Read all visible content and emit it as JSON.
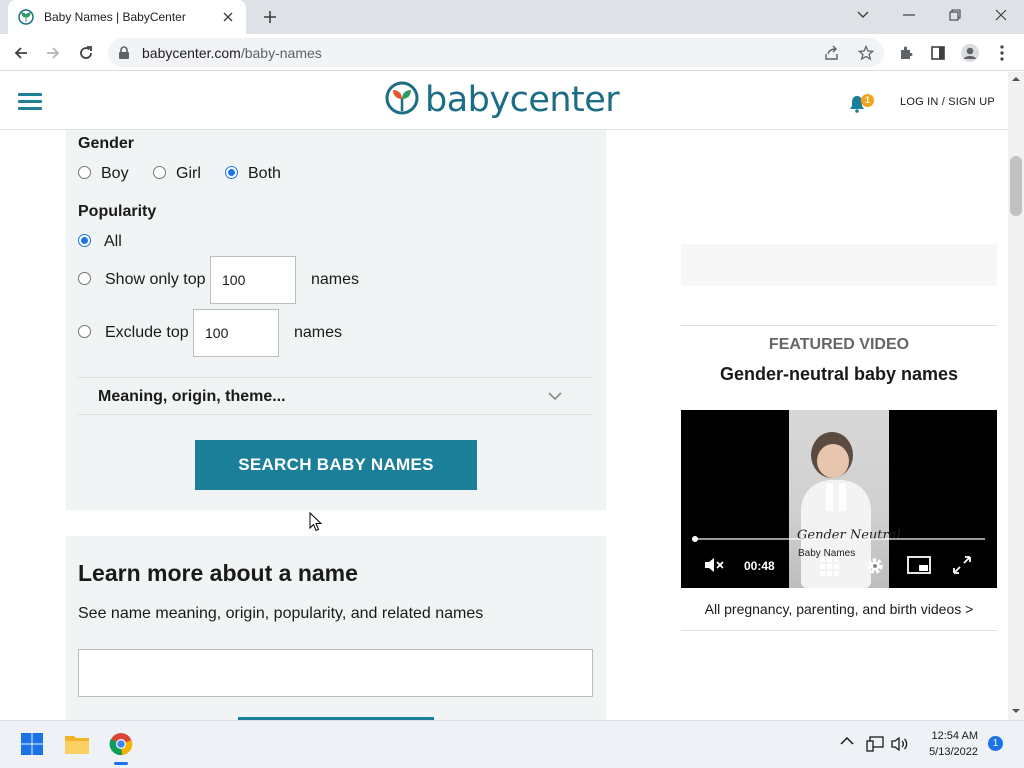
{
  "browser": {
    "tab_title": "Baby Names | BabyCenter",
    "url_host": "babycenter.com",
    "url_path": "/baby-names"
  },
  "header": {
    "logo_text": "babycenter",
    "notification_count": "1",
    "login_label": "LOG IN / SIGN UP"
  },
  "search": {
    "gender_label": "Gender",
    "gender_options": [
      "Boy",
      "Girl",
      "Both"
    ],
    "gender_selected": "Both",
    "popularity_label": "Popularity",
    "popularity_all": "All",
    "show_top_label": "Show only top",
    "show_top_value": "100",
    "exclude_top_label": "Exclude top",
    "exclude_top_value": "100",
    "names_suffix": "names",
    "popularity_selected": "All",
    "meaning_label": "Meaning, origin, theme...",
    "search_button": "SEARCH BABY NAMES"
  },
  "learn": {
    "title": "Learn more about a name",
    "subtitle": "See name meaning, origin, popularity, and related names",
    "input_value": ""
  },
  "featured": {
    "label": "FEATURED VIDEO",
    "title": "Gender-neutral baby names",
    "video_time": "00:48",
    "watermark_script": "Gender Neutral",
    "watermark_text": "Baby Names",
    "all_videos_link": "All pregnancy, parenting, and birth videos >"
  },
  "taskbar": {
    "time": "12:54 AM",
    "date": "5/13/2022",
    "notification_count": "1"
  },
  "colors": {
    "brand_teal": "#1b7f99",
    "panel_bg": "#f1f4f5",
    "radio_blue": "#1a73e8"
  }
}
